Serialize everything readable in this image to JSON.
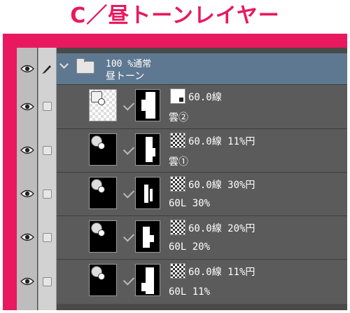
{
  "title": "C／昼トーンレイヤー",
  "colors": {
    "frame": "#e8195f",
    "title": "#e8195f",
    "folder_row": "#5f7891",
    "layer_row": "#5b5b5b"
  },
  "folder": {
    "opacity_blend": "100 %通常",
    "name": "昼トーン",
    "icon": "folder-icon"
  },
  "layers": [
    {
      "tone_setting": "60.0線",
      "name": "雲②"
    },
    {
      "tone_setting": "60.0線 11%円",
      "name": "雲①"
    },
    {
      "tone_setting": "60.0線 30%円",
      "name": "60L 30%"
    },
    {
      "tone_setting": "60.0線 20%円",
      "name": "60L 20%"
    },
    {
      "tone_setting": "60.0線 11%円",
      "name": "60L 11%"
    }
  ]
}
